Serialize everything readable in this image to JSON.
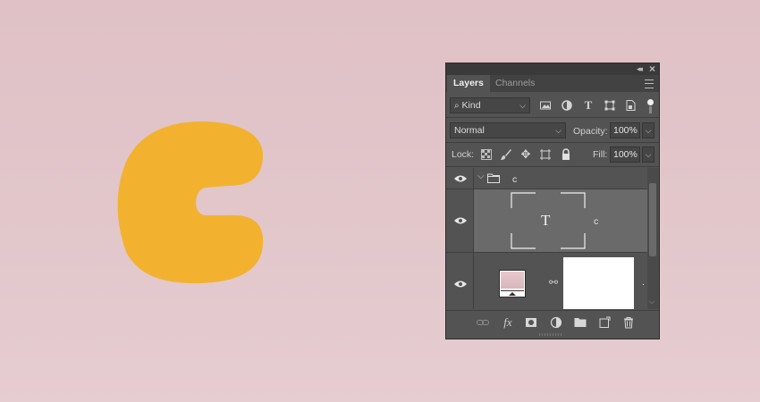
{
  "canvas": {
    "background": "#e0c3c8",
    "shape_color": "#f2b230",
    "shape": "letter-c-shape"
  },
  "panel": {
    "tabs": [
      {
        "label": "Layers",
        "active": true
      },
      {
        "label": "Channels",
        "active": false
      }
    ],
    "filter": {
      "kind_label": "Kind",
      "icons": [
        "image-filter-icon",
        "adjustment-filter-icon",
        "type-filter-icon",
        "shape-filter-icon",
        "smart-object-filter-icon",
        "filter-toggle-icon"
      ]
    },
    "blend": {
      "mode": "Normal",
      "opacity_label": "Opacity:",
      "opacity_value": "100%"
    },
    "lock": {
      "label": "Lock:",
      "fill_label": "Fill:",
      "fill_value": "100%",
      "icons": [
        "lock-transparent-pixels-icon",
        "lock-image-pixels-icon",
        "lock-position-icon",
        "lock-artboard-icon",
        "lock-all-icon"
      ]
    },
    "layers": [
      {
        "type": "group",
        "name": "c",
        "visible": true,
        "expanded": true
      },
      {
        "type": "text",
        "name": "c",
        "visible": true,
        "selected": true,
        "thumb_glyph": "T"
      },
      {
        "type": "fill",
        "name": ".",
        "visible": true
      }
    ],
    "bottom_icons": [
      "link-layers-icon",
      "fx-icon",
      "add-mask-icon",
      "adjustment-layer-icon",
      "new-group-icon",
      "new-layer-icon",
      "delete-layer-icon"
    ],
    "fx_label": "fx"
  }
}
